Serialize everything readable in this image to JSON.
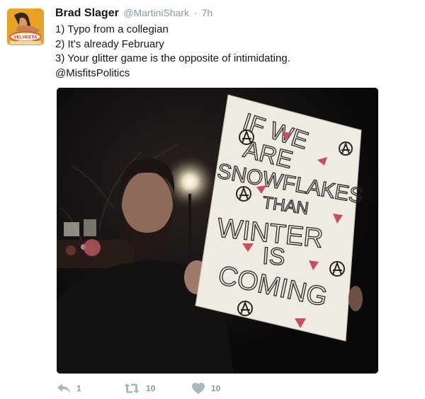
{
  "tweet": {
    "author": {
      "display_name": "Brad Slager",
      "handle": "@MartiniShark",
      "avatar_icon": "velveeta-avatar",
      "avatar_logo_text": "VELVEETA"
    },
    "separator": "·",
    "timestamp": "7h",
    "text_lines": [
      "1) Typo from a collegian",
      "2) It's already February",
      "3) Your glitter game is the opposite of intimidating.",
      "@MisfitsPolitics"
    ],
    "media": {
      "sign_text_lines": [
        "IF WE",
        "ARE",
        "SNOWFLAKES",
        "THAN",
        "WINTER",
        "IS",
        "COMING"
      ]
    },
    "actions": {
      "reply": {
        "icon": "reply-icon",
        "count": "1"
      },
      "retweet": {
        "icon": "retweet-icon",
        "count": "10"
      },
      "like": {
        "icon": "heart-icon",
        "count": "10"
      }
    },
    "colors": {
      "name": "#14171a",
      "secondary": "#8899a6",
      "action_icon": "#aab8c2",
      "glitter": "#c4505f"
    }
  }
}
